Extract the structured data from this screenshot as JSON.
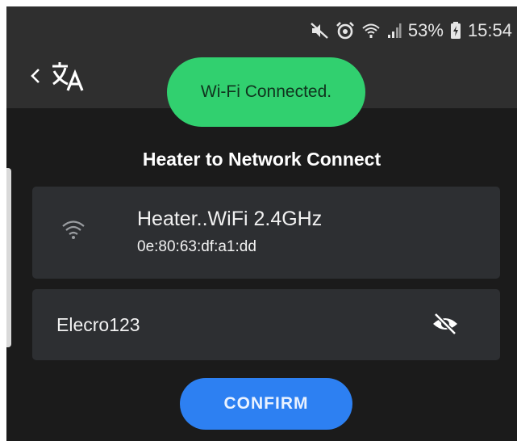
{
  "status_bar": {
    "icons": [
      "mute-icon",
      "alarm-icon",
      "wifi-calling-icon",
      "signal-icon"
    ],
    "battery_percent": "53%",
    "time": "15:54"
  },
  "toolbar": {
    "back_icon": "chevron-left-icon",
    "translate_icon": "translate-icon"
  },
  "toast": {
    "message": "Wi-Fi Connected."
  },
  "page": {
    "title": "Heater to Network Connect"
  },
  "network": {
    "icon": "wifi-icon",
    "name": "Heater..WiFi 2.4GHz",
    "mac": "0e:80:63:df:a1:dd"
  },
  "password": {
    "value": "Elecro123",
    "toggle_icon": "eye-off-icon"
  },
  "actions": {
    "confirm_label": "CONFIRM"
  },
  "colors": {
    "toast": "#31d06f",
    "confirm": "#2d80f2",
    "card": "#2d2f32",
    "background": "#1b1b1b",
    "toolbar": "#2f2f2f"
  }
}
